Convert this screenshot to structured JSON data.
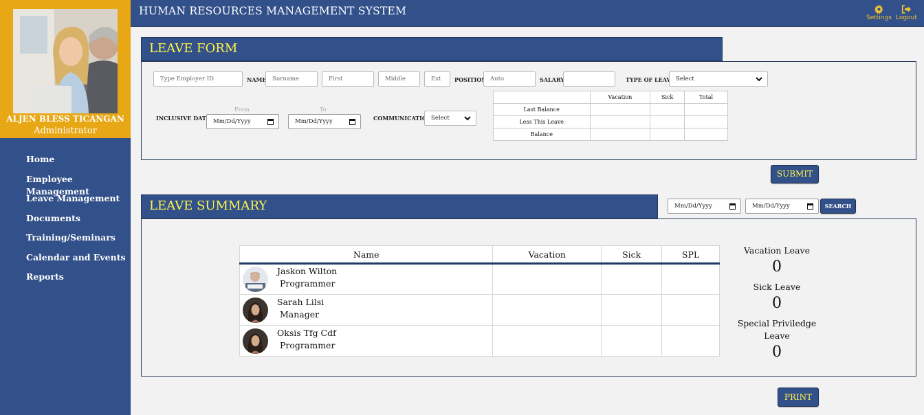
{
  "app": {
    "title": "HUMAN RESOURCES MANAGEMENT SYSTEM"
  },
  "topbar": {
    "settings_label": "Settings",
    "logout_label": "Logout"
  },
  "profile": {
    "name": "ALJEN BLESS TICANGAN",
    "role": "Administrator"
  },
  "sidebar": {
    "items": [
      {
        "label": "Home"
      },
      {
        "label": "Employee Management"
      },
      {
        "label": "Leave Management"
      },
      {
        "label": "Documents"
      },
      {
        "label": "Training/Seminars"
      },
      {
        "label": "Calendar and Events"
      },
      {
        "label": "Reports"
      }
    ]
  },
  "leave_form": {
    "title": "LEAVE FORM",
    "employer_id_placeholder": "Type Employer ID",
    "name_label": "NAME",
    "surname_placeholder": "Surname",
    "first_placeholder": "First",
    "middle_placeholder": "Middle",
    "ext_placeholder": "Ext",
    "position_label": "POSITION",
    "position_placeholder": "Auto",
    "salary_label": "SALARY",
    "salary_value": "",
    "type_label": "TYPE OF LEAVE",
    "type_value": "Select",
    "inclusive_label": "INCLUSIVE DATES",
    "from_label": "From",
    "to_label": "To",
    "from_value": "Mm/Dd/Yyyy",
    "to_value": "Mm/Dd/Yyyy",
    "communication_label": "COMMUNICATION",
    "communication_value": "Select",
    "balance_headers": [
      "",
      "Vacation",
      "Sick",
      "Total"
    ],
    "balance_rows": [
      "Last Balance",
      "Less This Leave",
      "Balance"
    ],
    "submit_label": "SUBMIT"
  },
  "leave_summary": {
    "title": "LEAVE SUMMARY",
    "date_from": "Mm/Dd/Yyyy",
    "date_to": "Mm/Dd/Yyyy",
    "search_label": "SEARCH",
    "columns": [
      "Name",
      "Vacation",
      "Sick",
      "SPL"
    ],
    "rows": [
      {
        "name": "Jaskon Wilton",
        "title": "Programmer"
      },
      {
        "name": "Sarah Lilsi",
        "title": "Manager"
      },
      {
        "name": "Oksis Tfg Cdf",
        "title": "Programmer"
      }
    ],
    "stats": {
      "vacation_label": "Vacation Leave",
      "vacation_value": "0",
      "sick_label": "Sick Leave",
      "sick_value": "0",
      "spl_label_1": "Special Priviledge",
      "spl_label_2": "Leave",
      "spl_value": "0"
    },
    "print_label": "PRINT"
  }
}
